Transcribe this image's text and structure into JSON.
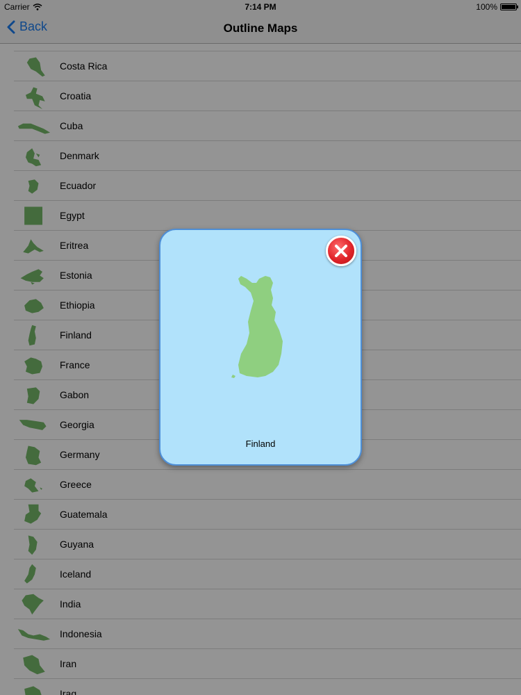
{
  "status_bar": {
    "carrier": "Carrier",
    "time": "7:14 PM",
    "battery": "100%"
  },
  "nav_bar": {
    "back_label": "Back",
    "title": "Outline Maps"
  },
  "list": {
    "items": [
      {
        "label": "Costa Rica"
      },
      {
        "label": "Croatia"
      },
      {
        "label": "Cuba"
      },
      {
        "label": "Denmark"
      },
      {
        "label": "Ecuador"
      },
      {
        "label": "Egypt"
      },
      {
        "label": "Eritrea"
      },
      {
        "label": "Estonia"
      },
      {
        "label": "Ethiopia"
      },
      {
        "label": "Finland"
      },
      {
        "label": "France"
      },
      {
        "label": "Gabon"
      },
      {
        "label": "Georgia"
      },
      {
        "label": "Germany"
      },
      {
        "label": "Greece"
      },
      {
        "label": "Guatemala"
      },
      {
        "label": "Guyana"
      },
      {
        "label": "Iceland"
      },
      {
        "label": "India"
      },
      {
        "label": "Indonesia"
      },
      {
        "label": "Iran"
      },
      {
        "label": "Iraq"
      }
    ]
  },
  "popup": {
    "country_label": "Finland",
    "close_icon": "close-icon"
  },
  "colors": {
    "accent": "#1a7cf0",
    "map_green": "#76b86a",
    "popup_background": "#b1e2fb",
    "popup_border": "#4e8ed6",
    "close_red": "#e0242a"
  }
}
